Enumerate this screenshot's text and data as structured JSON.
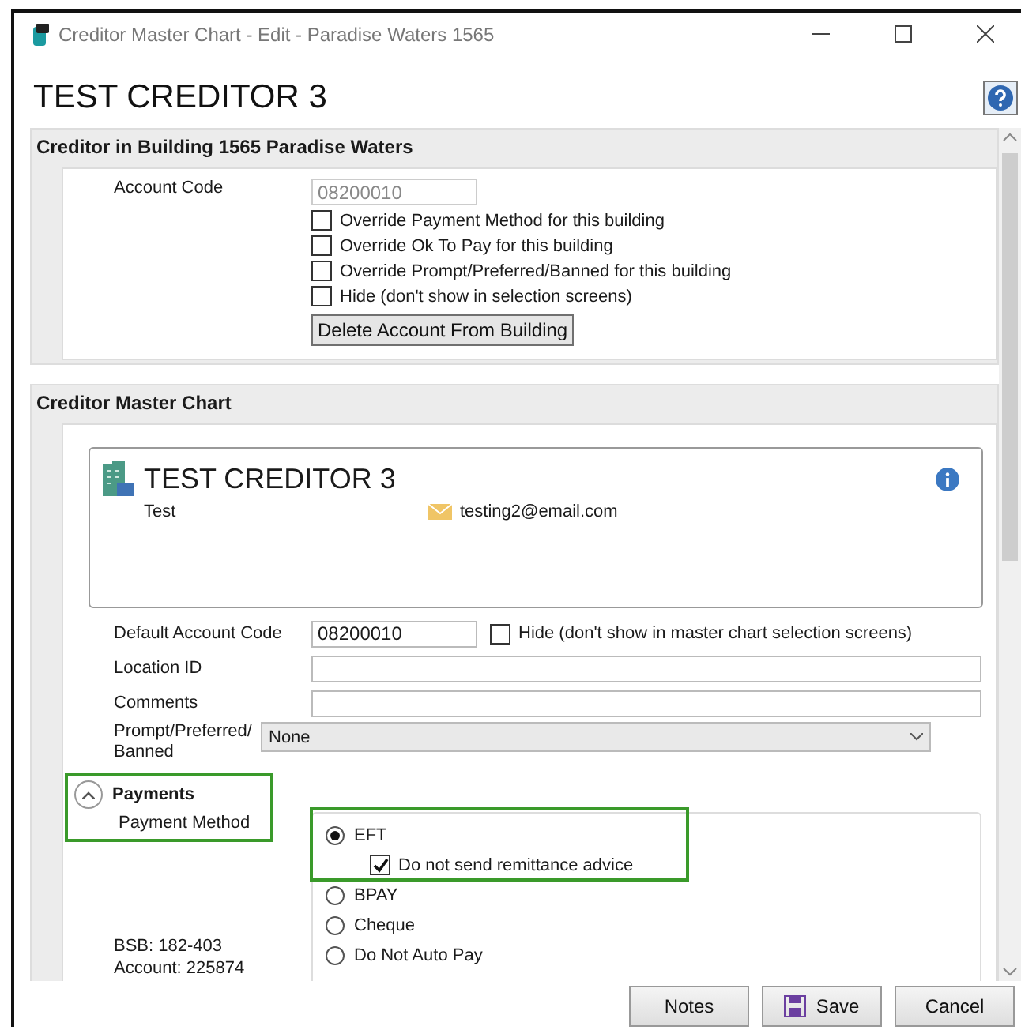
{
  "window": {
    "title": "Creditor Master Chart - Edit - Paradise Waters 1565"
  },
  "heading": "TEST CREDITOR 3",
  "building_section": {
    "title": "Creditor in Building 1565 Paradise Waters",
    "account_code": {
      "label": "Account Code",
      "value": "08200010",
      "disabled": true
    },
    "options": [
      {
        "label": "Override Payment Method for this building",
        "checked": false
      },
      {
        "label": "Override Ok To Pay for this building",
        "checked": false
      },
      {
        "label": "Override Prompt/Preferred/Banned for this building",
        "checked": false
      },
      {
        "label": "Hide (don't show in selection screens)",
        "checked": false
      }
    ],
    "delete_button": "Delete Account From Building"
  },
  "master_section": {
    "title": "Creditor Master Chart",
    "card": {
      "name": "TEST CREDITOR 3",
      "contact": "Test",
      "email": "testing2@email.com"
    },
    "default_account_code": {
      "label": "Default Account Code",
      "value": "08200010"
    },
    "hide_option": {
      "label": "Hide (don't show in master chart selection screens)",
      "checked": false
    },
    "location_id": {
      "label": "Location ID"
    },
    "comments": {
      "label": "Comments"
    },
    "prompt": {
      "label": "Prompt/Preferred/Banned",
      "value": "None"
    }
  },
  "payments": {
    "title": "Payments",
    "expanded": true,
    "method_label": "Payment Method",
    "bank_details": [
      "BSB: 182-403",
      "Account: 225874"
    ],
    "methods": [
      {
        "label": "EFT",
        "selected": true,
        "options": [
          {
            "label": "Do not send remittance advice",
            "checked": true
          }
        ]
      },
      {
        "label": "BPAY",
        "selected": false
      },
      {
        "label": "Cheque",
        "selected": false
      },
      {
        "label": "Do Not Auto Pay",
        "selected": false
      }
    ]
  },
  "buttons": [
    {
      "label": "Notes",
      "kind": "plain"
    },
    {
      "label": "Save",
      "kind": "save"
    },
    {
      "label": "Cancel",
      "kind": "plain"
    }
  ]
}
